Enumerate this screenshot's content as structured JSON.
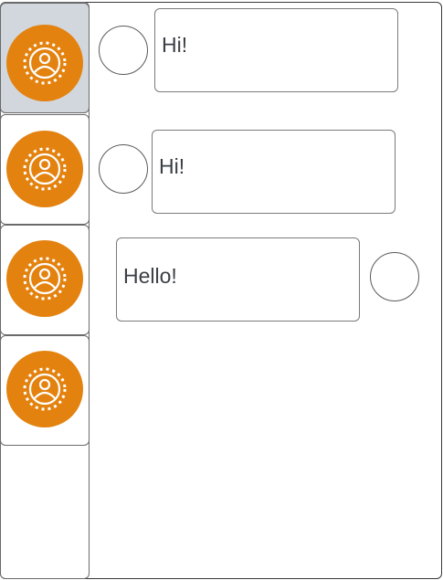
{
  "colors": {
    "avatar_orange": "#E3820F",
    "selected_bg": "#D2D7DE"
  },
  "contacts": [
    {
      "avatar_icon": "user-icon",
      "selected": true
    },
    {
      "avatar_icon": "user-icon",
      "selected": false
    },
    {
      "avatar_icon": "user-icon",
      "selected": false
    },
    {
      "avatar_icon": "user-icon",
      "selected": false
    }
  ],
  "messages": [
    {
      "text": "Hi!",
      "side": "incoming"
    },
    {
      "text": "Hi!",
      "side": "incoming"
    },
    {
      "text": "Hello!",
      "side": "outgoing"
    }
  ]
}
